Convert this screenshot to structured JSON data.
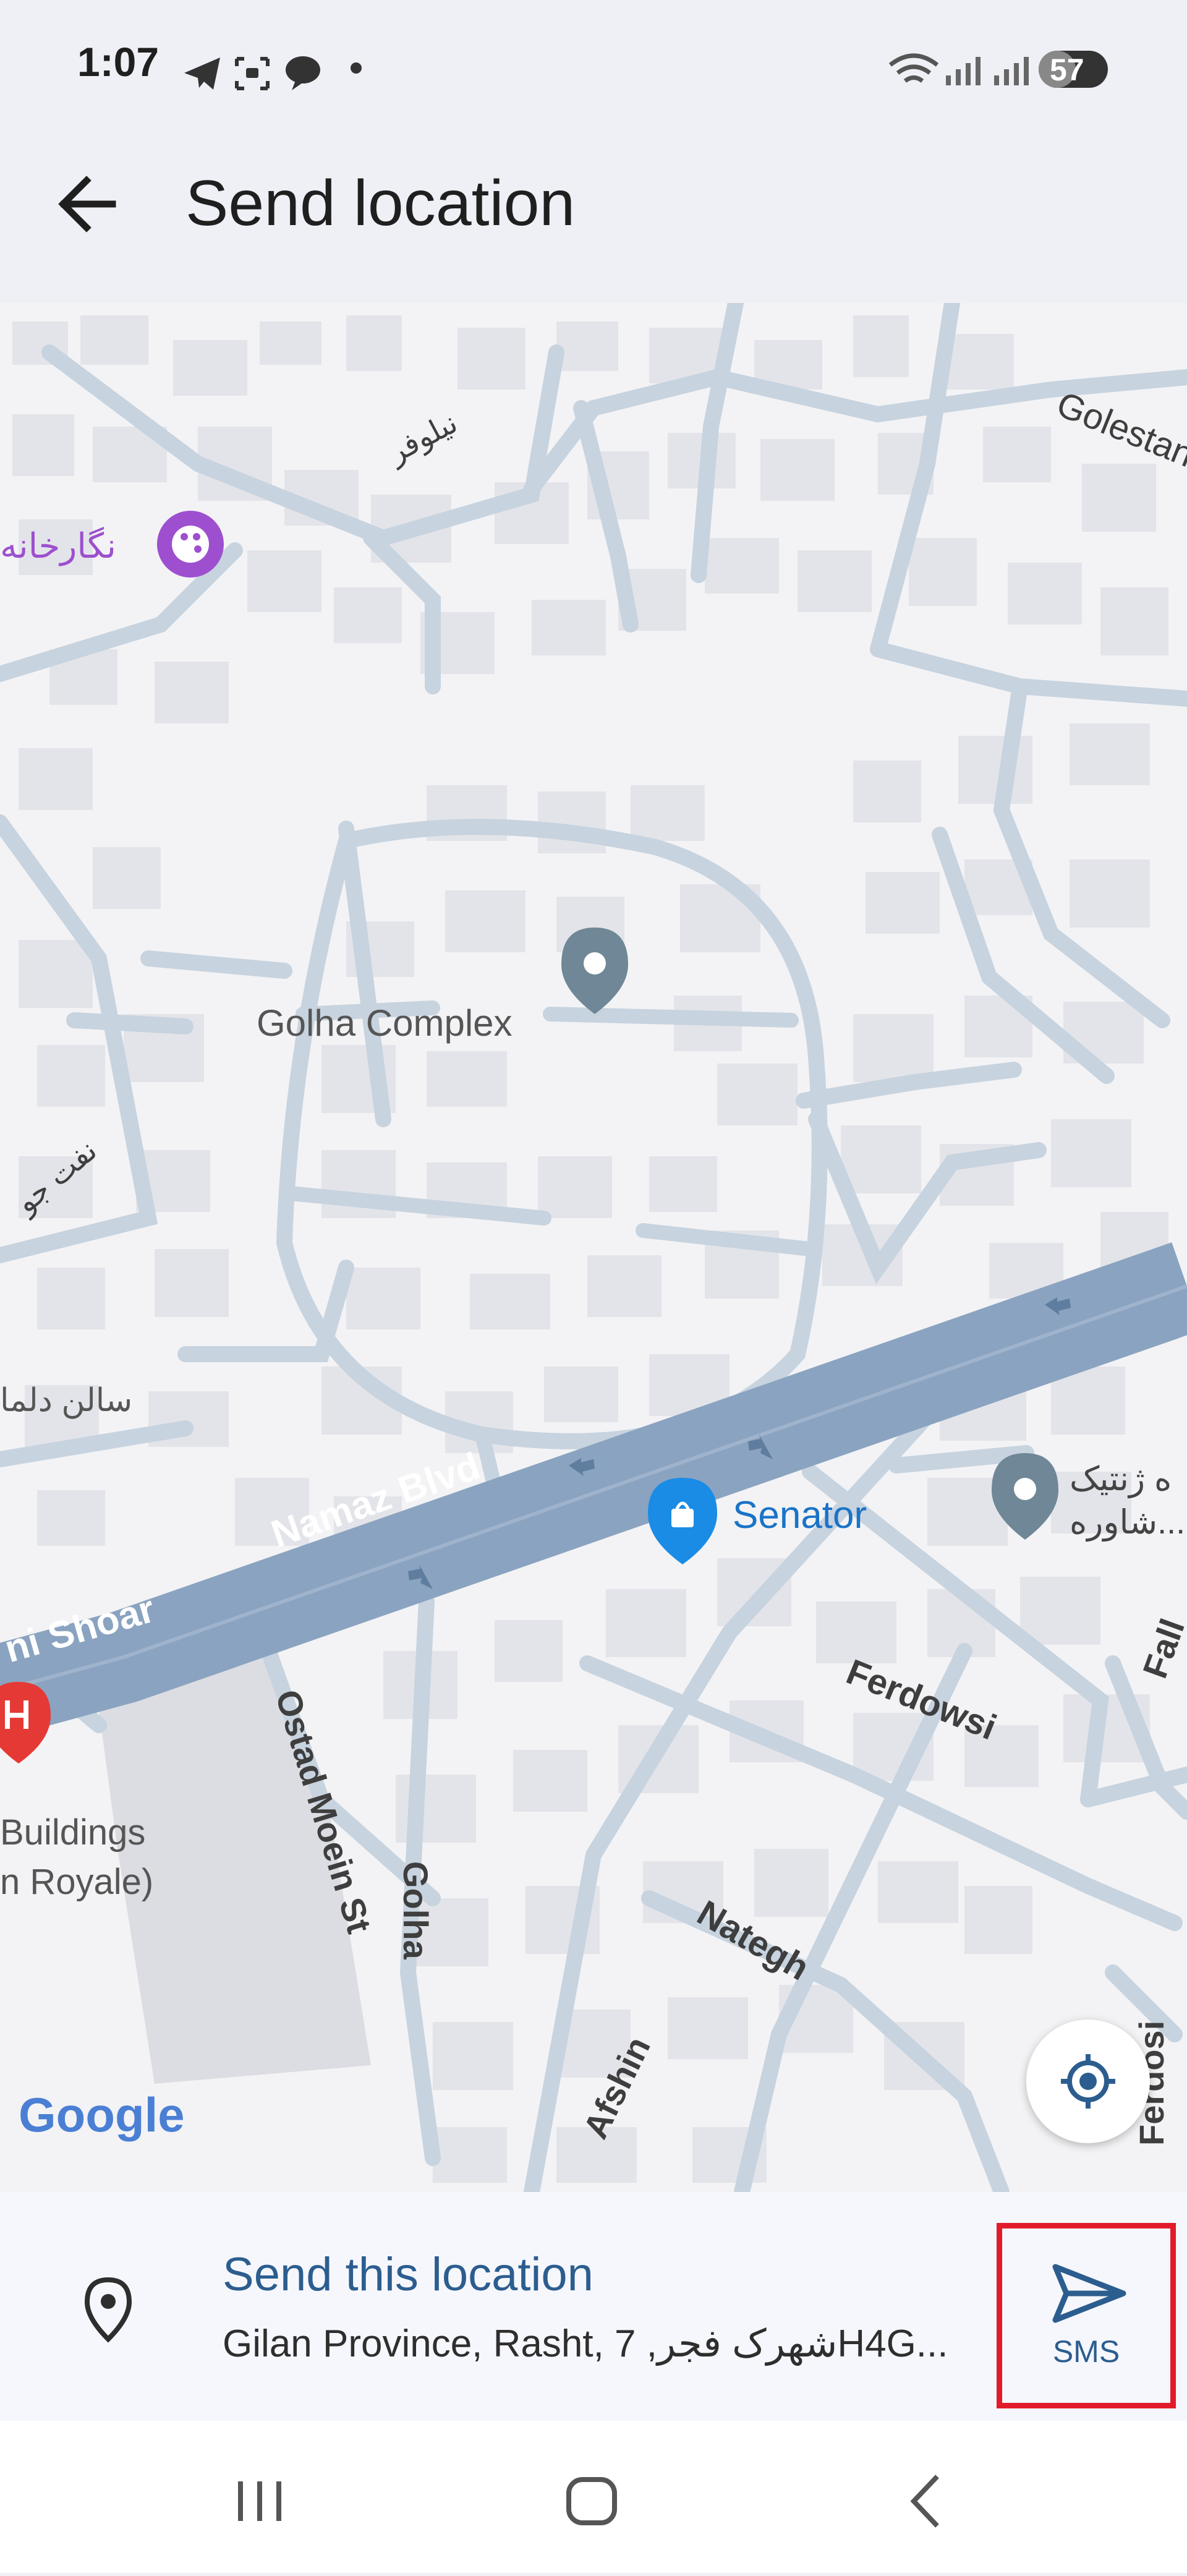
{
  "status_bar": {
    "time": "1:07",
    "battery": "57"
  },
  "app_bar": {
    "title": "Send location",
    "back_icon": "arrow-left-icon"
  },
  "map": {
    "labels": {
      "niloufar": "نیلوفر",
      "negarkhaneh": "نگارخانه",
      "golestan": "Golestan",
      "golha_complex": "Golha Complex",
      "nafat_jo": "نفت جو",
      "salon_dolma": "سالن دلما",
      "namaz_blvd": "Namaz Blvd",
      "senator": "Senator",
      "genetic_line1": "ه ژنتیک",
      "genetic_line2": "شاوره...",
      "shoar": "ni Shoar",
      "golha_street": "Golha",
      "ferdowsi": "Ferdowsi",
      "ferdosi": "Ferdosi",
      "fall": "Fall",
      "ostad_moein": "Ostad Moein St",
      "buildings_line1": "Buildings",
      "buildings_line2": "n Royale)",
      "nategh": "Nategh",
      "afshin": "Afshin",
      "google": "Google"
    },
    "colors": {
      "background": "#f3f3f5",
      "building": "#e3e4e9",
      "road": "#c7d3df",
      "boulevard": "#8aa3c0",
      "poi_pin": "#6f8796",
      "senator_pin": "#1a8ce6",
      "hospital": "#e53935",
      "art_poi": "#9d4fcf"
    }
  },
  "bottom_panel": {
    "pin_icon": "location-pin-icon",
    "title": "Send this location",
    "address": "Gilan Province, Rasht, 7 ,شهرک فجرH4G...",
    "sms_label": "SMS",
    "send_icon": "send-icon"
  },
  "nav_bar": {
    "recents_icon": "recents-icon",
    "home_icon": "home-icon",
    "back_icon": "back-icon"
  }
}
